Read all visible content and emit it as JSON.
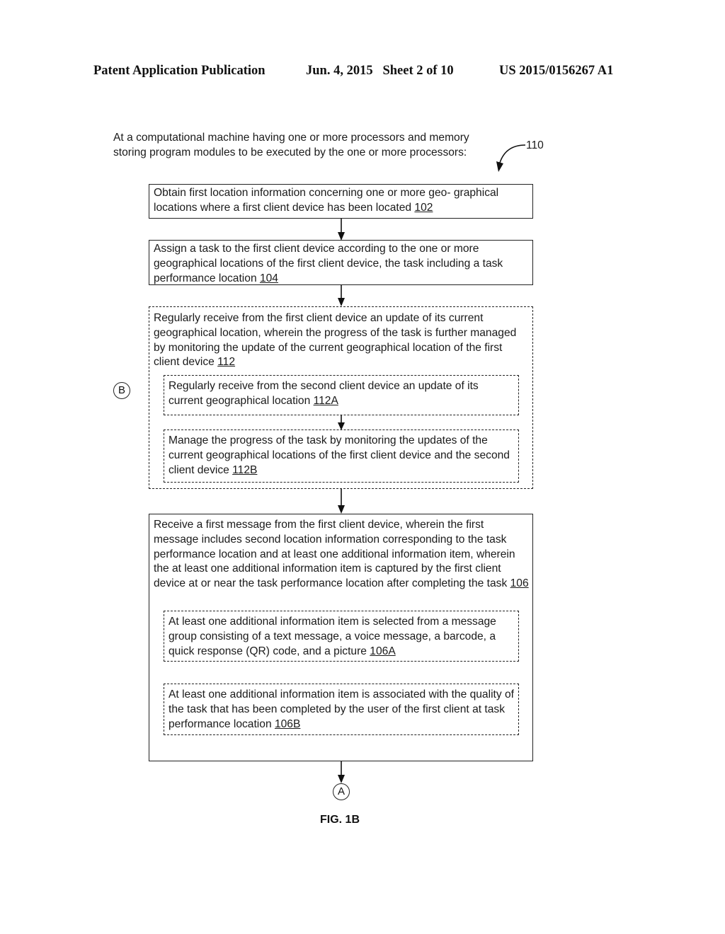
{
  "header": {
    "publication": "Patent Application Publication",
    "date_sheet": "Jun. 4, 2015   Sheet 2 of 10",
    "number": "US 2015/0156267 A1"
  },
  "preamble": "At a computational machine having one or more processors and memory storing program modules to be executed by the one or more processors:",
  "reference_110": "110",
  "steps": {
    "s102": {
      "text": "Obtain first location information concerning one or more geo- graphical locations where a first client device has been located ",
      "ref": "102"
    },
    "s104": {
      "text": "Assign a task to the first client device according to the one or more geographical locations of the first client device, the task including a task performance location ",
      "ref": "104"
    },
    "s112": {
      "text": "Regularly receive from the first client device an update of its current geographical location, wherein the progress of the task is further managed by monitoring the update of the current geographical location of the first client device ",
      "ref": "112"
    },
    "s112a": {
      "text": "Regularly receive from the second client device an update of its current geographical location ",
      "ref": "112A"
    },
    "s112b": {
      "text": "Manage the progress of the task by monitoring the updates of the current geographical locations of the first client device and the second client device ",
      "ref": "112B"
    },
    "s106": {
      "text": "Receive a first message from the first client device, wherein the first message includes second location information corresponding to the task performance location and at least one additional information item, wherein the at least one additional information item is captured by the first client device at or near the task performance location after completing the task ",
      "ref": "106"
    },
    "s106a": {
      "text": "At least one additional information item is selected from a message group consisting of a text message, a voice message, a barcode, a quick response (QR) code, and a picture ",
      "ref": "106A"
    },
    "s106b": {
      "text": "At least one additional information item is associated with the quality of the task that has been completed by the user of the first client at task performance location ",
      "ref": "106B"
    }
  },
  "connectors": {
    "b": "B",
    "a": "A"
  },
  "figure_label": "FIG. 1B"
}
